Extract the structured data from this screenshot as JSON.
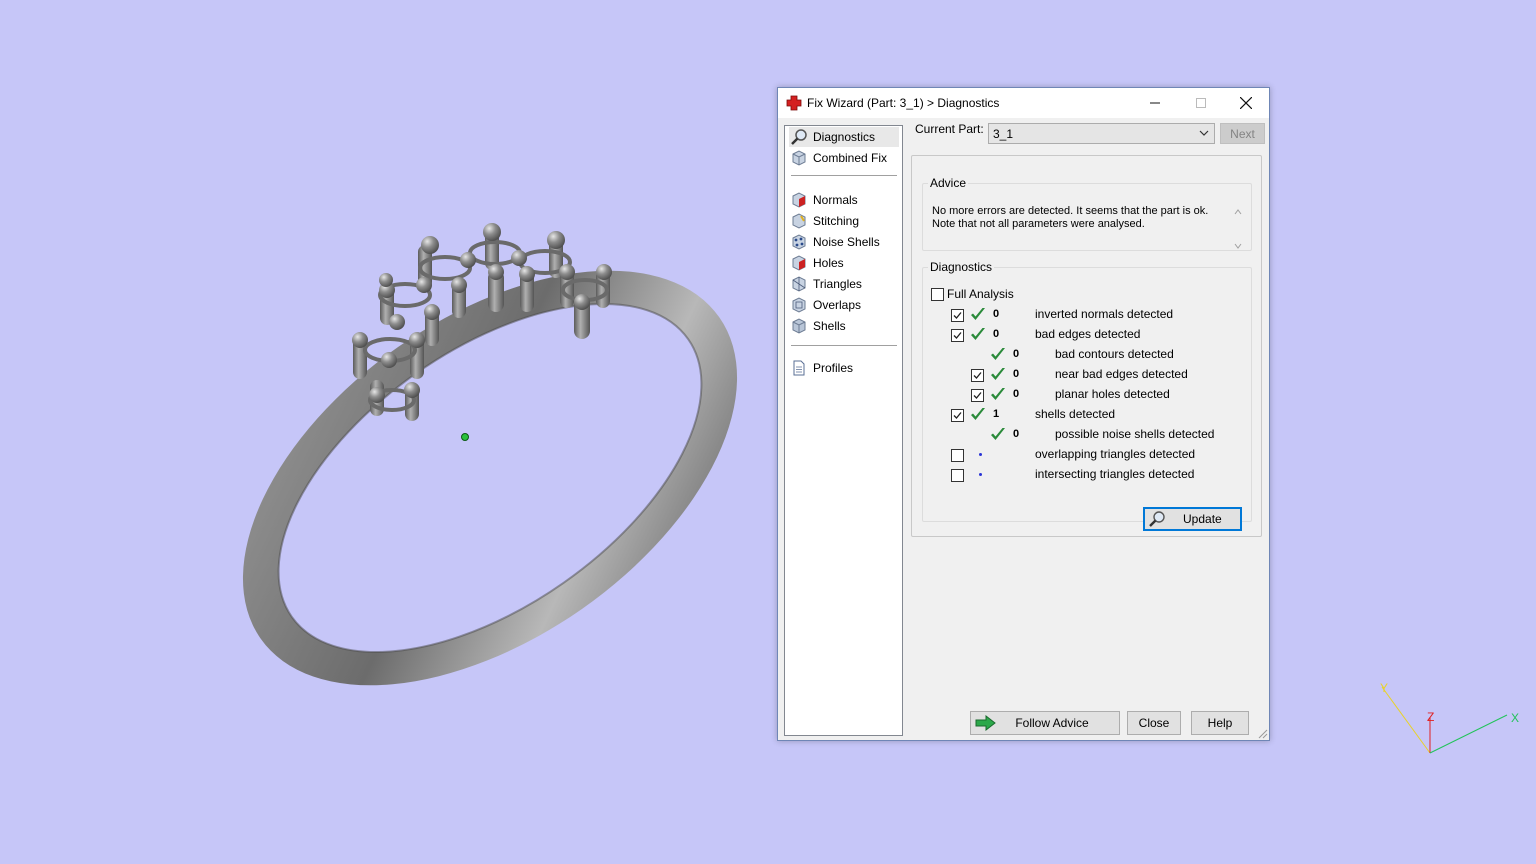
{
  "colors": {
    "viewport_background": "#c6c6f8",
    "check_green": "#2a8a3a",
    "focus_blue": "#0078d7",
    "axis_x": "#22c35a",
    "axis_y": "#e8d22a",
    "axis_z": "#e02020"
  },
  "viewport": {
    "model": "ring",
    "axes": {
      "x": "X",
      "y": "Y",
      "z": "Z"
    }
  },
  "dialog": {
    "title": "Fix Wizard (Part: 3_1) > Diagnostics",
    "icon": "red-cross-icon",
    "window_controls": [
      "minimize-icon",
      "maximize-icon",
      "close-icon"
    ],
    "nav": {
      "items": [
        {
          "label": "Diagnostics",
          "icon": "magnifier-icon",
          "selected": true
        },
        {
          "label": "Combined Fix",
          "icon": "cube-icon"
        },
        {
          "label": "Normals",
          "icon": "normals-cube-icon"
        },
        {
          "label": "Stitching",
          "icon": "stitching-cube-icon"
        },
        {
          "label": "Noise Shells",
          "icon": "noise-shells-icon"
        },
        {
          "label": "Holes",
          "icon": "holes-cube-icon"
        },
        {
          "label": "Triangles",
          "icon": "triangles-cube-icon"
        },
        {
          "label": "Overlaps",
          "icon": "overlaps-cube-icon"
        },
        {
          "label": "Shells",
          "icon": "shells-cube-icon"
        },
        {
          "label": "Profiles",
          "icon": "document-icon"
        }
      ]
    },
    "current_part": {
      "label": "Current Part:",
      "value": "3_1"
    },
    "next_label": "Next",
    "advice": {
      "title": "Advice",
      "text": "No more errors are detected. It seems that the part is ok.\nNote that not all parameters were analysed."
    },
    "diagnostics": {
      "title": "Diagnostics",
      "full_analysis_label": "Full Analysis",
      "full_analysis_checked": false,
      "rows": [
        {
          "label": "inverted normals detected",
          "count": "0",
          "checkbox": true,
          "checked": true,
          "status": "ok",
          "indent": 0
        },
        {
          "label": "bad edges detected",
          "count": "0",
          "checkbox": true,
          "checked": true,
          "status": "ok",
          "indent": 0
        },
        {
          "label": "bad contours detected",
          "count": "0",
          "checkbox": false,
          "checked": false,
          "status": "ok",
          "indent": 1
        },
        {
          "label": "near bad edges detected",
          "count": "0",
          "checkbox": true,
          "checked": true,
          "status": "ok",
          "indent": 1
        },
        {
          "label": "planar holes detected",
          "count": "0",
          "checkbox": true,
          "checked": true,
          "status": "ok",
          "indent": 1
        },
        {
          "label": "shells detected",
          "count": "1",
          "checkbox": true,
          "checked": true,
          "status": "ok",
          "indent": 0
        },
        {
          "label": "possible noise shells detected",
          "count": "0",
          "checkbox": false,
          "checked": false,
          "status": "ok",
          "indent": 1
        },
        {
          "label": "overlapping triangles detected",
          "count": "",
          "checkbox": true,
          "checked": false,
          "status": "pending",
          "indent": 0
        },
        {
          "label": "intersecting triangles detected",
          "count": "",
          "checkbox": true,
          "checked": false,
          "status": "pending",
          "indent": 0
        }
      ],
      "update_label": "Update"
    },
    "footer": {
      "follow_advice_label": "Follow Advice",
      "close_label": "Close",
      "help_label": "Help"
    }
  }
}
